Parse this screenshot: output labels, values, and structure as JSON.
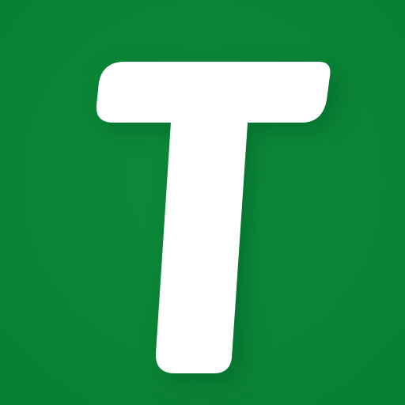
{
  "app_icon": {
    "glyph_icon": "letter-t-glyph",
    "colors": {
      "background": "#0C8A3A",
      "background_edge": "#088033",
      "glyph": "#FFFFFF",
      "shadow": "#0A5F28"
    }
  }
}
